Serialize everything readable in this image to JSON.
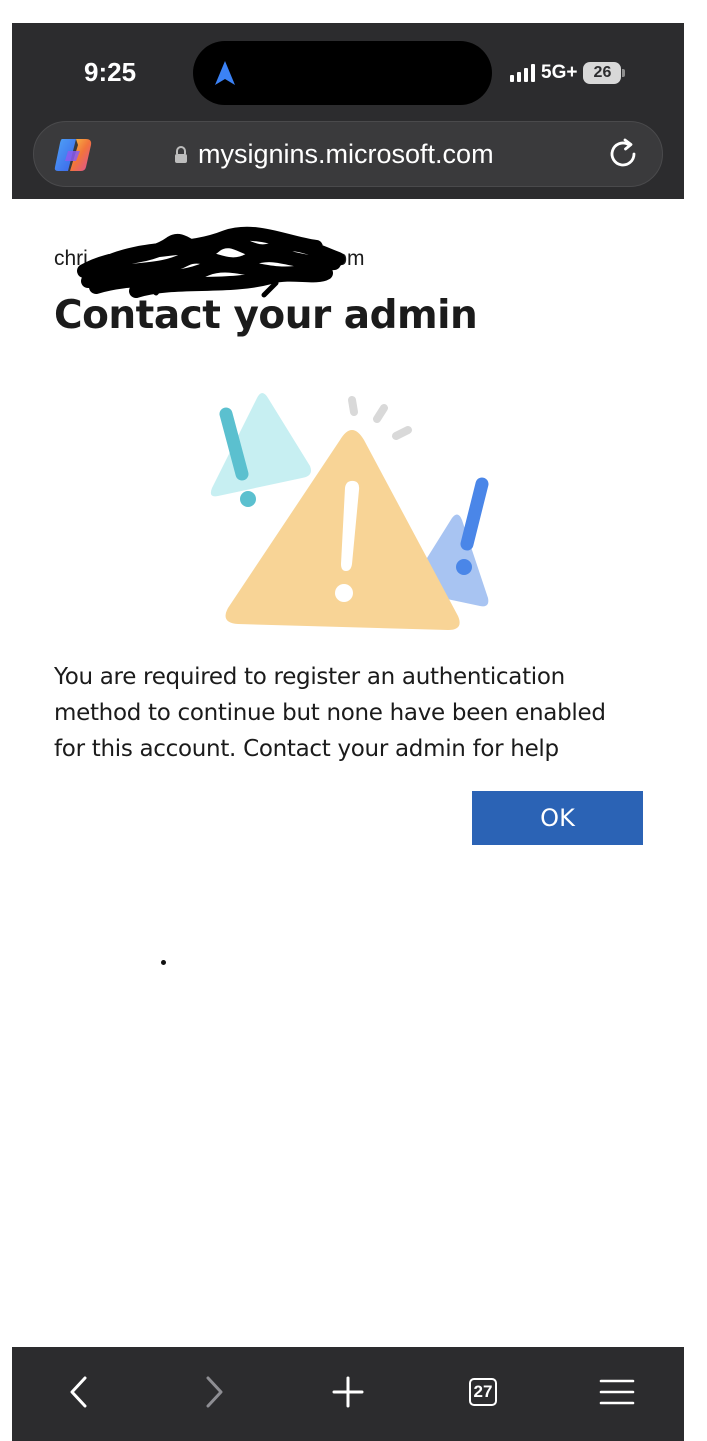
{
  "status_bar": {
    "time": "9:25",
    "network": "5G+",
    "battery": "26"
  },
  "address_bar": {
    "url": "mysignins.microsoft.com"
  },
  "page": {
    "email_visible_start": "chri",
    "email_visible_end": ".com",
    "title": "Contact your admin",
    "message": "You are required to register an authentication method to continue but none have been enabled for this account. Contact your admin for help",
    "ok_label": "OK"
  },
  "toolbar": {
    "tab_count": "27"
  },
  "colors": {
    "chrome_bg": "#2c2c2e",
    "primary_button": "#2b63b5",
    "warning_triangle": "#f8d496",
    "teal_triangle": "#c7eff2",
    "blue_triangle": "#a8c4f2"
  },
  "icons": [
    "navigation-arrow-icon",
    "signal-icon",
    "battery-icon",
    "copilot-icon",
    "lock-icon",
    "reload-icon",
    "back-icon",
    "forward-icon",
    "new-tab-icon",
    "tabs-icon",
    "menu-icon"
  ]
}
